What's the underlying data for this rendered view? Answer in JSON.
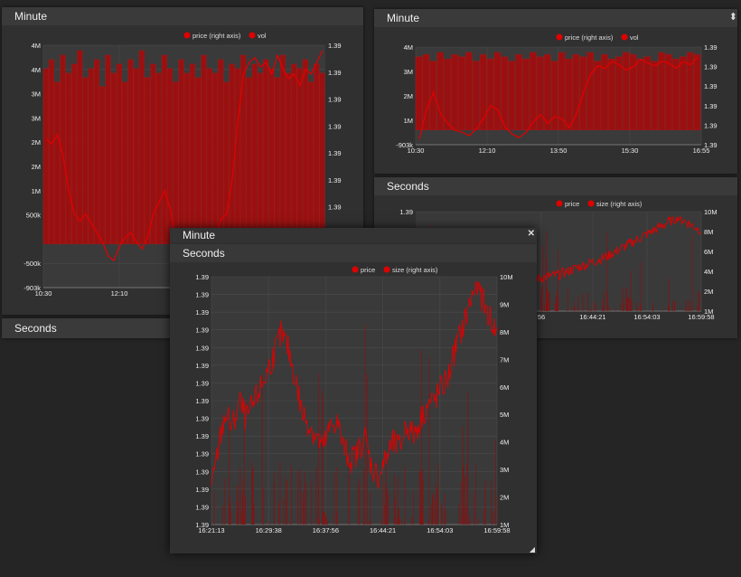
{
  "colors": {
    "background": "#252525",
    "panel": "#303030",
    "plot_bg": "#3a3a3a",
    "series": "#e00000",
    "series_fill": "#9a1010"
  },
  "panel_a": {
    "title": "Minute",
    "lower_title": "Seconds",
    "chart_data": {
      "type": "bar",
      "legend": [
        "price (right axis)",
        "vol"
      ],
      "legend_placement": "top",
      "grid": true,
      "x_ticks": [
        "10:30",
        "12:10"
      ],
      "y_left_ticks": [
        "4M",
        "4M",
        "3M",
        "3M",
        "2M",
        "2M",
        "1M",
        "500k",
        "",
        "-500k",
        "-903k"
      ],
      "y_right_ticks": [
        "1.39",
        "1.39",
        "1.39",
        "1.39",
        "1.39",
        "1.39",
        "1.39",
        "1.39",
        "1.39",
        "1.39"
      ],
      "series": [
        {
          "name": "vol",
          "values": [
            3.9,
            4.1,
            3.6,
            4.2,
            3.8,
            4.0,
            4.3,
            3.7,
            3.9,
            4.1,
            3.5,
            4.2,
            3.8,
            4.0,
            3.6,
            4.1,
            3.9,
            4.3,
            3.7,
            4.0,
            3.8,
            4.2,
            3.9,
            3.6,
            4.1,
            3.8,
            4.0,
            3.7,
            4.2,
            3.9,
            3.8,
            4.1,
            3.6,
            4.0,
            3.9,
            4.2,
            3.7,
            4.0,
            3.8,
            4.1,
            3.9,
            3.7,
            4.2,
            3.8,
            4.0,
            3.9,
            4.1,
            3.6,
            4.0,
            3.8
          ]
        },
        {
          "name": "price (right axis)",
          "values": [
            0.62,
            0.6,
            0.64,
            0.55,
            0.4,
            0.3,
            0.27,
            0.3,
            0.26,
            0.22,
            0.18,
            0.12,
            0.1,
            0.16,
            0.2,
            0.22,
            0.18,
            0.15,
            0.2,
            0.3,
            0.35,
            0.4,
            0.32,
            0.2,
            0.1,
            0.06,
            0.04,
            0.1,
            0.18,
            0.15,
            0.2,
            0.28,
            0.3,
            0.45,
            0.7,
            0.9,
            0.95,
            0.97,
            0.93,
            0.95,
            0.9,
            0.98,
            0.92,
            0.88,
            0.9,
            0.85,
            0.92,
            0.9,
            0.95,
            1.0
          ]
        }
      ]
    }
  },
  "panel_b": {
    "title": "Minute",
    "chart_data": {
      "type": "bar",
      "legend": [
        "price (right axis)",
        "vol"
      ],
      "legend_placement": "top",
      "grid": true,
      "x_ticks": [
        "10:30",
        "12:10",
        "13:50",
        "15:30",
        "16:55"
      ],
      "y_left_ticks": [
        "4M",
        "3M",
        "2M",
        "1M",
        "-903k"
      ],
      "y_right_ticks": [
        "1.39",
        "1.39",
        "1.39",
        "1.39",
        "1.39",
        "1.39"
      ],
      "series": [
        {
          "name": "vol",
          "values": [
            3.4,
            3.5,
            3.2,
            3.6,
            3.3,
            3.5,
            3.4,
            3.6,
            3.2,
            3.5,
            3.3,
            3.6,
            3.4,
            3.2,
            3.5,
            3.3,
            3.6,
            3.4,
            3.5,
            3.2,
            3.6,
            3.3,
            3.5,
            3.4,
            3.6,
            3.2,
            3.5,
            3.3,
            3.4,
            3.6,
            3.5,
            3.3,
            3.4,
            3.2,
            3.6,
            3.5,
            3.3,
            3.4,
            3.6,
            3.5
          ]
        },
        {
          "name": "price (right axis)",
          "values": [
            0.02,
            0.35,
            0.55,
            0.3,
            0.2,
            0.12,
            0.1,
            0.06,
            0.14,
            0.25,
            0.4,
            0.35,
            0.16,
            0.08,
            0.04,
            0.1,
            0.22,
            0.3,
            0.2,
            0.28,
            0.25,
            0.15,
            0.3,
            0.55,
            0.75,
            0.85,
            0.82,
            0.9,
            0.86,
            0.8,
            0.84,
            0.92,
            0.88,
            0.85,
            0.9,
            0.88,
            0.82,
            0.9,
            0.86,
            0.95
          ]
        }
      ]
    },
    "close_glyph": "⬍"
  },
  "panel_c": {
    "title": "Seconds",
    "chart_data": {
      "type": "line",
      "legend": [
        "price",
        "size (right axis)"
      ],
      "legend_placement": "top",
      "grid": true,
      "x_ticks": [
        "56",
        "16:44:21",
        "16:54:03",
        "16:59:58"
      ],
      "y_left_ticks": [
        "1.39",
        "1.39"
      ],
      "y_right_ticks": [
        "10M",
        "8M",
        "6M",
        "4M",
        "2M",
        "1M"
      ]
    }
  },
  "panel_d": {
    "title": "Minute",
    "subtitle": "Seconds",
    "close_glyph": "✕",
    "chart_data": {
      "type": "line",
      "legend": [
        "price",
        "size (right axis)"
      ],
      "legend_placement": "top",
      "grid": true,
      "x_ticks": [
        "16:21:13",
        "16:29:38",
        "16:37:56",
        "16:44:21",
        "16:54:03",
        "16:59:58"
      ],
      "y_left_ticks": [
        "1.39",
        "1.39",
        "1.39",
        "1.39",
        "1.39",
        "1.39",
        "1.39",
        "1.39",
        "1.39",
        "1.39",
        "1.39",
        "1.39",
        "1.39",
        "1.39",
        "1.39"
      ],
      "y_right_ticks": [
        "10M",
        "9M",
        "8M",
        "7M",
        "6M",
        "5M",
        "4M",
        "3M",
        "2M",
        "1M"
      ],
      "series": [
        {
          "name": "price",
          "values": [
            0.12,
            0.3,
            0.45,
            0.38,
            0.5,
            0.42,
            0.48,
            0.55,
            0.62,
            0.7,
            0.78,
            0.72,
            0.6,
            0.45,
            0.4,
            0.35,
            0.3,
            0.38,
            0.42,
            0.3,
            0.25,
            0.28,
            0.35,
            0.22,
            0.18,
            0.25,
            0.32,
            0.3,
            0.4,
            0.35,
            0.42,
            0.48,
            0.5,
            0.55,
            0.6,
            0.72,
            0.8,
            0.9,
            1.0,
            0.92,
            0.85,
            0.78
          ]
        }
      ]
    }
  }
}
